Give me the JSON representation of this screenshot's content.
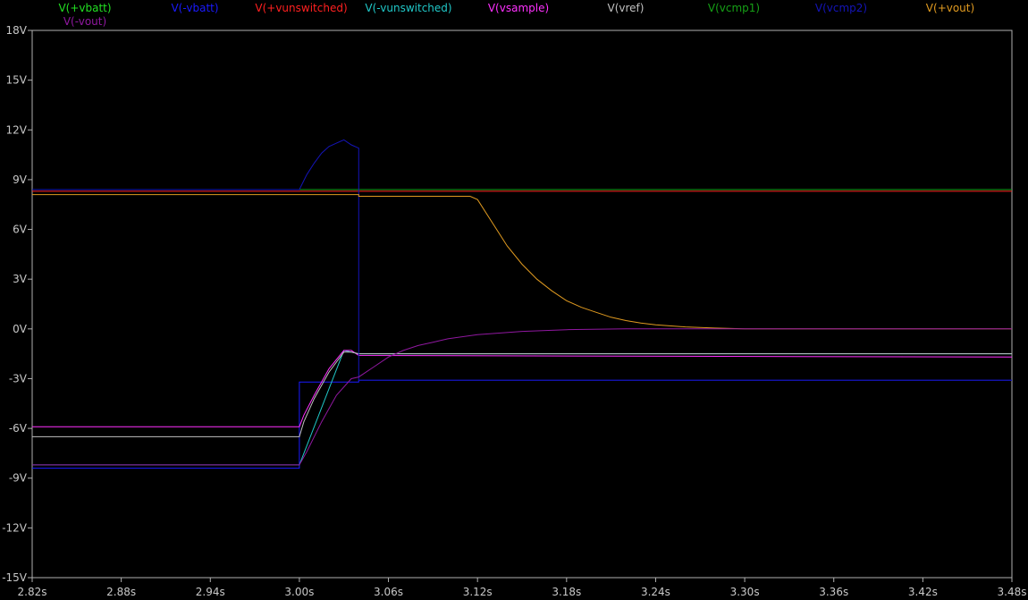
{
  "chart_data": {
    "type": "line",
    "title": "",
    "xlabel": "",
    "ylabel": "",
    "xlim": [
      2.82,
      3.48
    ],
    "ylim": [
      -15,
      18
    ],
    "grid": false,
    "legend_position": "top",
    "x_ticks": [
      "2.82s",
      "2.88s",
      "2.94s",
      "3.00s",
      "3.06s",
      "3.12s",
      "3.18s",
      "3.24s",
      "3.30s",
      "3.36s",
      "3.42s",
      "3.48s"
    ],
    "y_ticks": [
      "18V",
      "15V",
      "12V",
      "9V",
      "6V",
      "3V",
      "0V",
      "-3V",
      "-6V",
      "-9V",
      "-12V",
      "-15V"
    ],
    "series": [
      {
        "name": "V(+vbatt)",
        "color": "#22e022",
        "points": [
          [
            2.82,
            8.4
          ],
          [
            3.48,
            8.4
          ]
        ]
      },
      {
        "name": "V(-vbatt)",
        "color": "#1a1aff",
        "points": [
          [
            2.82,
            -8.4
          ],
          [
            3.0,
            -8.4
          ],
          [
            3.0,
            -3.2
          ],
          [
            3.04,
            -3.2
          ],
          [
            3.04,
            -3.1
          ],
          [
            3.48,
            -3.1
          ]
        ]
      },
      {
        "name": "V(+vunswitched)",
        "color": "#ff2020",
        "points": [
          [
            2.82,
            8.3
          ],
          [
            3.48,
            8.3
          ]
        ]
      },
      {
        "name": "V(-vunswitched)",
        "color": "#20c8c8",
        "points": [
          [
            2.82,
            -8.2
          ],
          [
            3.0,
            -8.2
          ],
          [
            3.03,
            -1.3
          ],
          [
            3.04,
            -1.5
          ],
          [
            3.48,
            -1.5
          ]
        ]
      },
      {
        "name": "V(vsample)",
        "color": "#ff30ff",
        "points": [
          [
            2.82,
            -5.9
          ],
          [
            3.0,
            -5.9
          ],
          [
            3.003,
            -5.2
          ],
          [
            3.01,
            -4.0
          ],
          [
            3.02,
            -2.4
          ],
          [
            3.03,
            -1.3
          ],
          [
            3.035,
            -1.3
          ],
          [
            3.04,
            -1.6
          ],
          [
            3.48,
            -1.7
          ]
        ]
      },
      {
        "name": "V(vref)",
        "color": "#c0c0c0",
        "points": [
          [
            2.82,
            -6.5
          ],
          [
            3.0,
            -6.5
          ],
          [
            3.003,
            -5.6
          ],
          [
            3.01,
            -4.2
          ],
          [
            3.02,
            -2.6
          ],
          [
            3.03,
            -1.4
          ],
          [
            3.035,
            -1.4
          ],
          [
            3.04,
            -1.5
          ],
          [
            3.48,
            -1.5
          ]
        ]
      },
      {
        "name": "V(vcmp1)",
        "color": "#16a016",
        "points": [
          [
            2.82,
            8.4
          ],
          [
            3.48,
            8.4
          ]
        ]
      },
      {
        "name": "V(vcmp2)",
        "color": "#1414b8",
        "points": [
          [
            2.82,
            8.4
          ],
          [
            3.0,
            8.4
          ],
          [
            3.005,
            9.3
          ],
          [
            3.01,
            10.0
          ],
          [
            3.015,
            10.6
          ],
          [
            3.02,
            11.0
          ],
          [
            3.025,
            11.2
          ],
          [
            3.03,
            11.4
          ],
          [
            3.035,
            11.1
          ],
          [
            3.04,
            10.9
          ],
          [
            3.04,
            -3.1
          ],
          [
            3.48,
            -3.1
          ]
        ]
      },
      {
        "name": "V(+vout)",
        "color": "#e09a20",
        "points": [
          [
            2.82,
            8.1
          ],
          [
            3.0,
            8.1
          ],
          [
            3.04,
            8.1
          ],
          [
            3.04,
            8.0
          ],
          [
            3.115,
            8.0
          ],
          [
            3.12,
            7.8
          ],
          [
            3.13,
            6.4
          ],
          [
            3.14,
            5.0
          ],
          [
            3.15,
            3.9
          ],
          [
            3.16,
            3.0
          ],
          [
            3.17,
            2.3
          ],
          [
            3.18,
            1.7
          ],
          [
            3.19,
            1.3
          ],
          [
            3.2,
            1.0
          ],
          [
            3.21,
            0.7
          ],
          [
            3.22,
            0.5
          ],
          [
            3.23,
            0.35
          ],
          [
            3.24,
            0.25
          ],
          [
            3.26,
            0.12
          ],
          [
            3.28,
            0.05
          ],
          [
            3.3,
            0.0
          ],
          [
            3.48,
            0.0
          ]
        ]
      },
      {
        "name": "V(-vout)",
        "color": "#9018a0",
        "points": [
          [
            2.82,
            -8.2
          ],
          [
            3.0,
            -8.2
          ],
          [
            3.005,
            -7.4
          ],
          [
            3.015,
            -5.6
          ],
          [
            3.025,
            -4.0
          ],
          [
            3.035,
            -3.0
          ],
          [
            3.04,
            -2.9
          ],
          [
            3.05,
            -2.3
          ],
          [
            3.06,
            -1.7
          ],
          [
            3.07,
            -1.3
          ],
          [
            3.08,
            -1.0
          ],
          [
            3.09,
            -0.8
          ],
          [
            3.1,
            -0.6
          ],
          [
            3.12,
            -0.35
          ],
          [
            3.15,
            -0.15
          ],
          [
            3.18,
            -0.05
          ],
          [
            3.22,
            0.0
          ],
          [
            3.48,
            0.0
          ]
        ]
      }
    ]
  }
}
